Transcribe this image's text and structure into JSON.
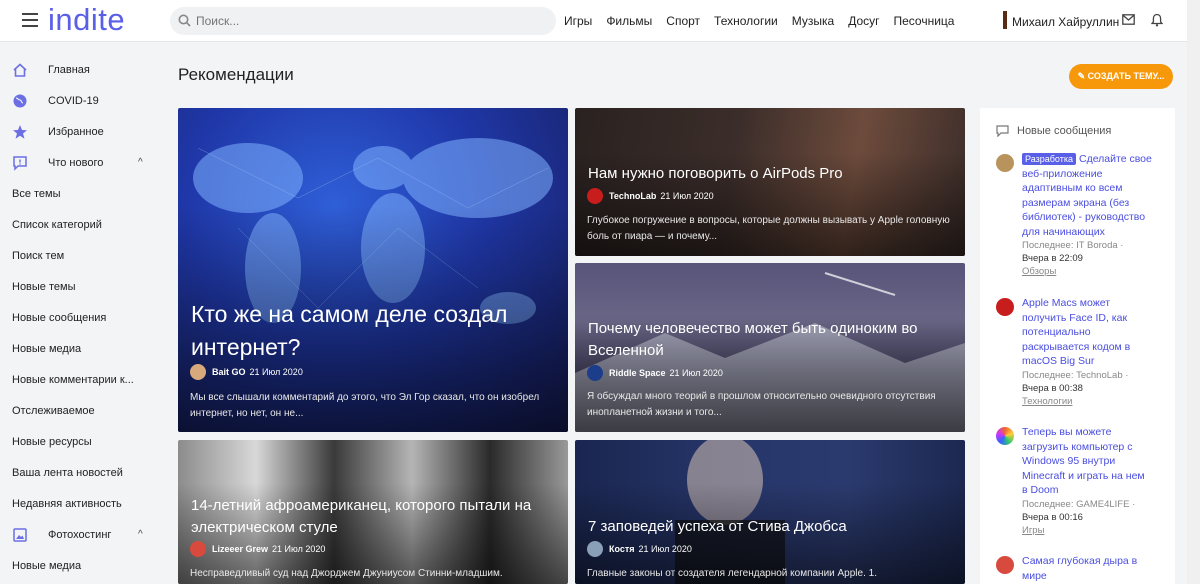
{
  "header": {
    "logo": "indite",
    "search_placeholder": "Поиск...",
    "nav": [
      "Игры",
      "Фильмы",
      "Спорт",
      "Технологии",
      "Музыка",
      "Досуг",
      "Песочница"
    ],
    "username": "Михаил Хайруллин"
  },
  "sidebar": {
    "items": [
      {
        "label": "Главная",
        "icon": "home-icon"
      },
      {
        "label": "COVID-19",
        "icon": "globe-icon"
      },
      {
        "label": "Избранное",
        "icon": "star-icon"
      },
      {
        "label": "Что нового",
        "icon": "chat-icon",
        "expanded": true
      },
      {
        "label": "Все темы"
      },
      {
        "label": "Список категорий"
      },
      {
        "label": "Поиск тем"
      },
      {
        "label": "Новые темы"
      },
      {
        "label": "Новые сообщения"
      },
      {
        "label": "Новые медиа"
      },
      {
        "label": "Новые комментарии к..."
      },
      {
        "label": "Отслеживаемое"
      },
      {
        "label": "Новые ресурсы"
      },
      {
        "label": "Ваша лента новостей"
      },
      {
        "label": "Недавняя активность"
      },
      {
        "label": "Фотохостинг",
        "icon": "image-icon",
        "expanded": true
      },
      {
        "label": "Новые медиа"
      }
    ]
  },
  "main": {
    "title": "Рекомендации",
    "create_button": "✎ СОЗДАТЬ ТЕМУ..."
  },
  "cards": [
    {
      "title": "Кто же на самом деле создал интернет?",
      "author": "Bait GO",
      "date": "21 Июл 2020",
      "excerpt": "Мы все слышали комментарий до этого, что Эл Гор сказал, что он изобрел интернет, но нет, он не..."
    },
    {
      "title": "Нам нужно поговорить о AirPods Pro",
      "author": "TechnoLab",
      "date": "21 Июл 2020",
      "excerpt": "Глубокое погружение в вопросы, которые должны вызывать у Apple головную боль от пиара — и почему..."
    },
    {
      "title": "Почему человечество может быть одиноким во Вселенной",
      "author": "Riddle Space",
      "date": "21 Июл 2020",
      "excerpt": "Я обсуждал много теорий в прошлом относительно очевидного отсутствия инопланетной жизни и того..."
    },
    {
      "title": "14-летний афроамериканец, которого пытали на электрическом стуле",
      "author": "Lizeeer Grew",
      "date": "21 Июл 2020",
      "excerpt": "Несправедливый суд над Джорджем Джуниусом Стинни-младшим."
    },
    {
      "title": "7 заповедей успеха от Стива Джобса",
      "author": "Костя",
      "date": "21 Июл 2020",
      "excerpt": "Главные законы от создателя легендарной компании Apple. 1."
    }
  ],
  "right_panel": {
    "heading": "Новые сообщения",
    "items": [
      {
        "badge": "Разработка",
        "title": "Сделайте свое веб-приложение адаптивным ко всем размерам экрана (без библиотек) - руководство для начинающих",
        "last": "Последнее: IT Boroda",
        "time": "Вчера в 22:09",
        "category": "Обзоры"
      },
      {
        "title": "Apple Macs может получить Face ID, как потенциально раскрывается кодом в macOS Big Sur",
        "last": "Последнее: TechnoLab",
        "time": "Вчера в 00:38",
        "category": "Технологии"
      },
      {
        "title": "Теперь вы можете загрузить компьютер с Windows 95 внутри Minecraft и играть на нем в Doom",
        "last": "Последнее: GAME4LIFE",
        "time": "Вчера в 00:16",
        "category": "Игры"
      },
      {
        "title": "Самая глубокая дыра в мире"
      }
    ]
  },
  "colors": {
    "accent": "#5a5fe8",
    "create_button": "#f7980a"
  }
}
